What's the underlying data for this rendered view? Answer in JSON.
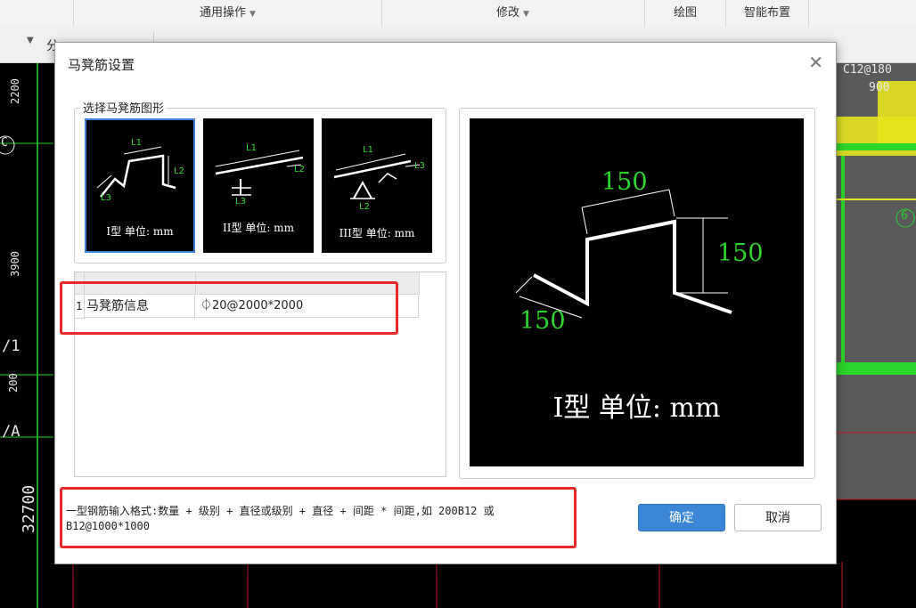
{
  "toolbar": {
    "groups": [
      "通用操作",
      "修改",
      "绘图",
      "智能布置"
    ],
    "subbar_label": "分"
  },
  "canvas": {
    "dims": [
      "2200",
      "3900",
      "200",
      "32700"
    ],
    "axis_labels": [
      "C",
      "/1",
      "/A",
      "6"
    ],
    "rebar_note": [
      "C12@180",
      "900"
    ],
    "colors": {
      "grid_red": "#c8151b",
      "wall_green": "#2bd52b",
      "wall_yellow": "#e6e61e",
      "panel_gray": "#5a5a5a"
    }
  },
  "dialog": {
    "title": "马凳筋设置",
    "group_label": "选择马凳筋图形",
    "shapes": [
      {
        "caption": "I型 单位: mm",
        "labels": [
          "L1",
          "L2",
          "L3"
        ]
      },
      {
        "caption": "II型 单位: mm",
        "labels": [
          "L1",
          "L2",
          "L3"
        ]
      },
      {
        "caption": "III型 单位: mm",
        "labels": [
          "L1",
          "L2",
          "L3"
        ]
      }
    ],
    "table": {
      "rows": [
        {
          "index": "1",
          "name": "马凳筋信息",
          "value": "⏀20@2000*2000"
        }
      ]
    },
    "preview": {
      "dims": [
        "150",
        "150",
        "150"
      ],
      "caption": "I型 单位: mm"
    },
    "hint": "一型钢筋输入格式:数量 + 级别 + 直径或级别 + 直径 + 间距 * 间距,如 200B12 或 B12@1000*1000",
    "ok_label": "确定",
    "cancel_label": "取消",
    "accent_color": "#3b86d6",
    "annotation_color": "#e8292a"
  }
}
